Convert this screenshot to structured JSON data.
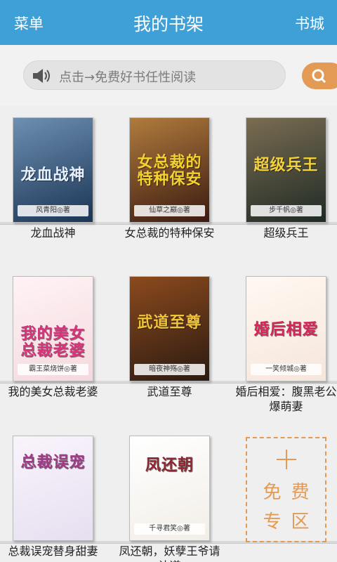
{
  "header": {
    "menu": "菜单",
    "title": "我的书架",
    "store": "书城"
  },
  "search": {
    "placeholder": "点击→免费好书任性阅读",
    "speaker_icon": "speaker-icon",
    "search_icon": "search-icon"
  },
  "books": [
    {
      "name": "龙血战神",
      "cover_title": "龙血战神",
      "author": "风青阳◎著",
      "colors": [
        "#1b3554",
        "#6d8fb2"
      ],
      "title_color": "#e8f2ff"
    },
    {
      "name": "女总裁的特种保安",
      "cover_title": "女总裁的特种保安",
      "author": "仙草之巅◎著",
      "colors": [
        "#3b1a10",
        "#b07b3d"
      ],
      "title_color": "#f3d22d"
    },
    {
      "name": "超级兵王",
      "cover_title": "超级兵王",
      "author": "步千帆◎著",
      "colors": [
        "#1f2a25",
        "#7a6d52"
      ],
      "title_color": "#f5d23a"
    },
    {
      "name": "我的美女总裁老婆",
      "cover_title": "我的美女总裁老婆",
      "author": "霸王菜烧饼◎著",
      "colors": [
        "#f4d9de",
        "#fff3f5"
      ],
      "title_color": "#d8337a"
    },
    {
      "name": "武道至尊",
      "cover_title": "武道至尊",
      "author": "暗夜神殇◎著",
      "colors": [
        "#2a1a12",
        "#8c4a1d"
      ],
      "title_color": "#f0c43a"
    },
    {
      "name": "婚后相爱：腹黑老公爆萌妻",
      "cover_title": "婚后相爱",
      "author": "一笑倾城◎著",
      "colors": [
        "#f6e6dc",
        "#fff8f2"
      ],
      "title_color": "#d9245a"
    },
    {
      "name": "总裁误宠替身甜妻",
      "cover_title": "总裁误宠",
      "author": "",
      "colors": [
        "#e6dff0",
        "#f9f4fc"
      ],
      "title_color": "#a13a86"
    },
    {
      "name": "凤还朝，妖孽王爷请让道",
      "cover_title": "凤还朝",
      "author": "千寻君笑◎著",
      "colors": [
        "#f2eee8",
        "#ffffff"
      ],
      "title_color": "#8c2630"
    }
  ],
  "free_zone": {
    "plus_icon": "plus-icon",
    "line1": "免费",
    "line2": "专区",
    "color": "#e29a55"
  }
}
